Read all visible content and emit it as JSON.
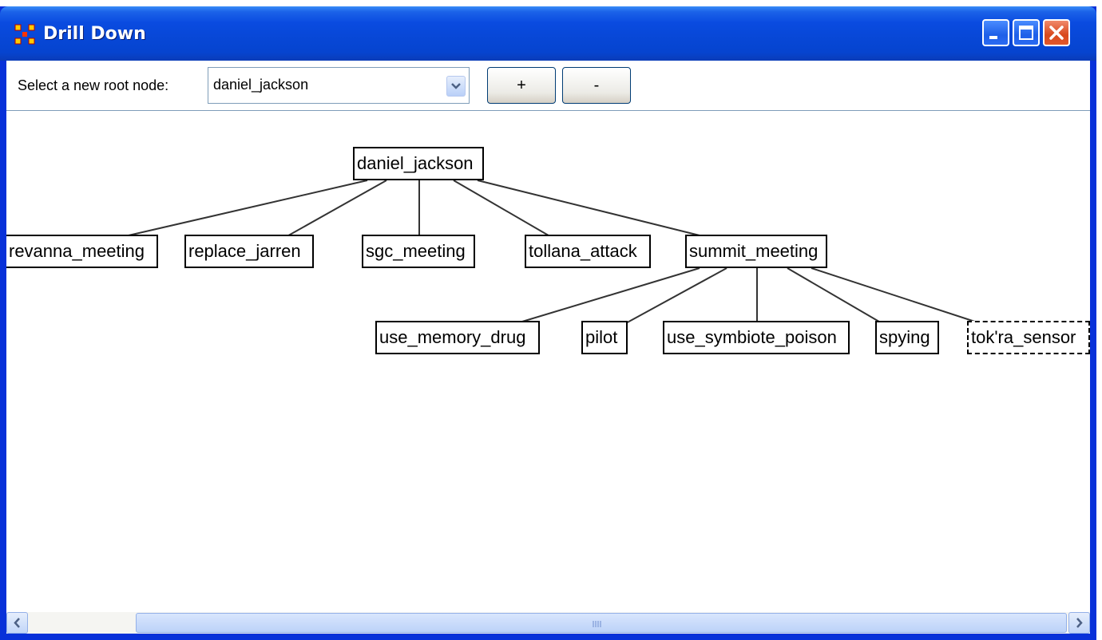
{
  "window": {
    "title": "Drill Down",
    "buttons": [
      "minimize",
      "maximize",
      "close"
    ]
  },
  "toolbar": {
    "root_label": "Select a new root node:",
    "root_value": "daniel_jackson",
    "plus_label": "+",
    "minus_label": "-"
  },
  "tree": {
    "root": "daniel_jackson",
    "level1": [
      "revanna_meeting",
      "replace_jarren",
      "sgc_meeting",
      "tollana_attack",
      "summit_meeting"
    ],
    "level2_parent": "summit_meeting",
    "level2": [
      "use_memory_drug",
      "pilot",
      "use_symbiote_poison",
      "spying",
      "tok'ra_sensor"
    ]
  },
  "scrollbar": {
    "orientation": "horizontal"
  },
  "colors": {
    "titlebar": "#0a4be0",
    "close_button": "#d8481c",
    "canvas": "#ffffff",
    "node_border": "#000000"
  }
}
